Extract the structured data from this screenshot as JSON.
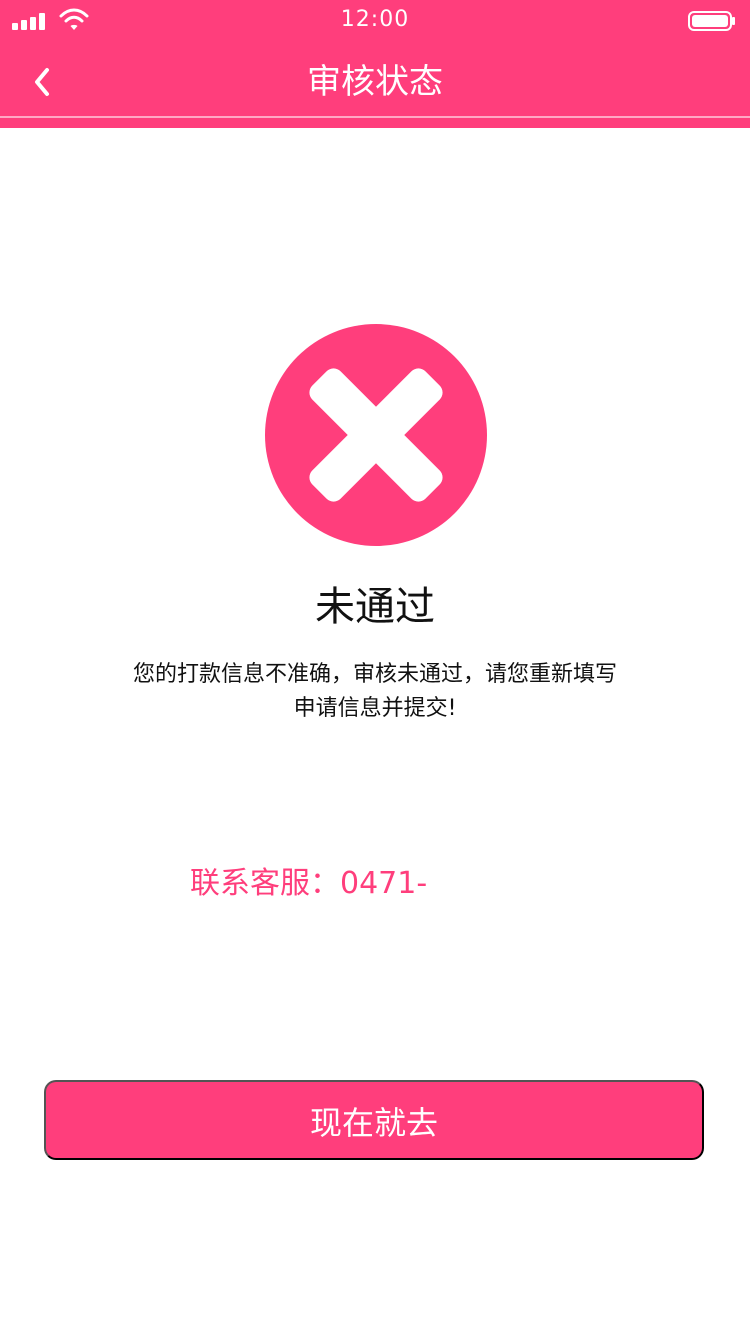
{
  "status_bar": {
    "time": "12:00",
    "icons": [
      "signal-icon",
      "wifi-icon",
      "battery-icon"
    ]
  },
  "header": {
    "title": "审核状态",
    "back_icon": "chevron-left-icon"
  },
  "result": {
    "icon": "close-icon",
    "title": "未通过",
    "description_line1": "您的打款信息不准确，审核未通过，请您重新填写",
    "description_line2": "申请信息并提交!"
  },
  "contact": {
    "text": "联系客服：0471-"
  },
  "actions": {
    "primary_label": "现在就去"
  },
  "colors": {
    "accent": "#ff3e7c",
    "text": "#111111",
    "background": "#ffffff"
  }
}
